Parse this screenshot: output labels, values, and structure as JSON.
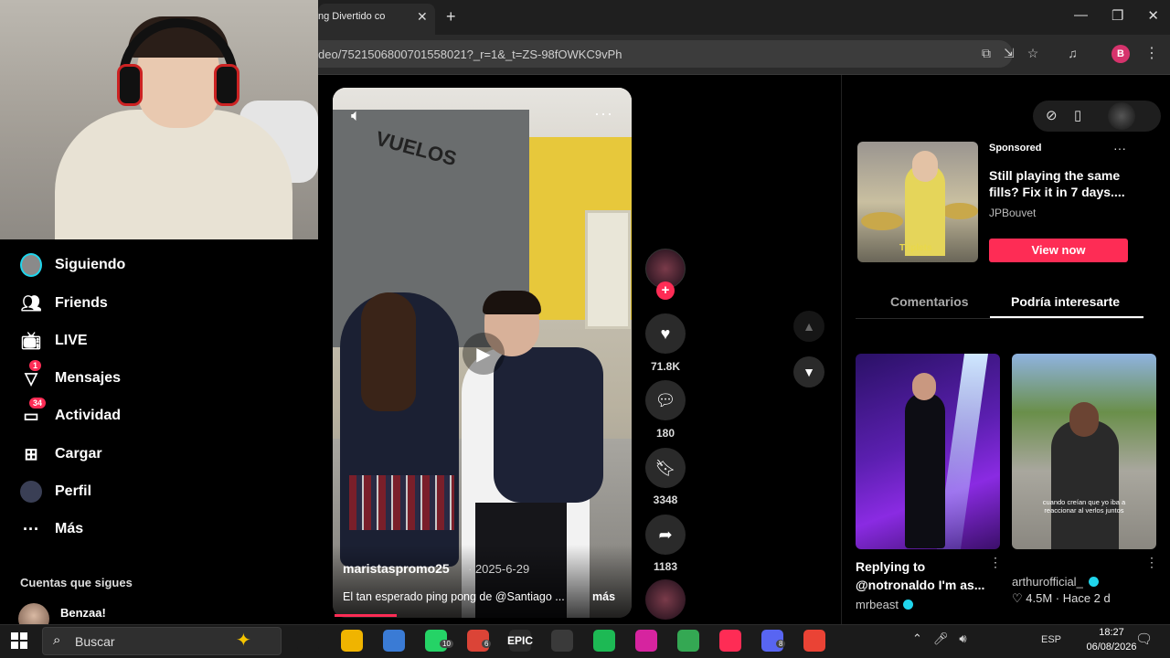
{
  "browser": {
    "tab_title": "ng Divertido co",
    "tab_close": "✕",
    "new_tab": "+",
    "window_controls": [
      "—",
      "❐",
      "✕"
    ],
    "url": "deo/7521506800701558021?_r=1&_t=ZS-98fOWKC9vPh",
    "profile_letter": "B",
    "menu": "⋮"
  },
  "sidebar": {
    "items": [
      {
        "label": "Siguiendo",
        "icon": "following-avatar-icon"
      },
      {
        "label": "Friends",
        "icon": "friends-icon"
      },
      {
        "label": "LIVE",
        "icon": "live-icon"
      },
      {
        "label": "Mensajes",
        "icon": "messages-icon",
        "badge": "1"
      },
      {
        "label": "Actividad",
        "icon": "activity-icon",
        "badge": "34"
      },
      {
        "label": "Cargar",
        "icon": "upload-icon"
      },
      {
        "label": "Perfil",
        "icon": "profile-avatar-icon"
      },
      {
        "label": "Más",
        "icon": "more-icon"
      }
    ],
    "following_title": "Cuentas que sigues",
    "following_accounts": [
      {
        "name": "Benzaa!"
      }
    ]
  },
  "video": {
    "author": "maristaspromo25",
    "date": "· 2025-6-29",
    "caption": "El tan esperado ping pong de @Santiago ...",
    "more_label": "más",
    "board_text": "VUELOS",
    "progress": 0.21
  },
  "actions": {
    "likes": "71.8K",
    "comments": "180",
    "saves": "3348",
    "shares": "1183"
  },
  "right_panel": {
    "ad": {
      "sponsored": "Sponsored",
      "title": "Still playing the same fills? Fix it in 7 days....",
      "brand": "JPBouvet",
      "cta": "View now",
      "thumb_overlay": "Triplets"
    },
    "tabs": [
      "Comentarios",
      "Podría interesarte"
    ],
    "active_tab": "Podría interesarte",
    "recommendations": [
      {
        "title": "Replying to @notronaldo I'm as...",
        "author": "mrbeast",
        "verified": true
      },
      {
        "author": "arthurofficial_",
        "verified": true,
        "stats": "♡ 4.5M · Hace 2 d",
        "overlay_caption": "cuando creían que yo iba a reaccionar al verlos juntos"
      }
    ]
  },
  "taskbar": {
    "search_placeholder": "Buscar",
    "apps": [
      {
        "name": "task-view-icon",
        "color": "#1b1b1b"
      },
      {
        "name": "file-explorer-icon",
        "color": "#f0b400"
      },
      {
        "name": "microsoft-store-icon",
        "color": "#3a7bd5"
      },
      {
        "name": "whatsapp-icon",
        "color": "#25d366",
        "badge": "10"
      },
      {
        "name": "chrome-icon",
        "color": "#db4437",
        "badge": "6"
      },
      {
        "name": "epic-games-icon",
        "color": "#2a2a2a",
        "label": "EPIC"
      },
      {
        "name": "obs-icon",
        "color": "#3a3a3a"
      },
      {
        "name": "spotify-icon",
        "color": "#1db954"
      },
      {
        "name": "instagram-icon",
        "color": "#d6249f"
      },
      {
        "name": "drive-icon",
        "color": "#34a853"
      },
      {
        "name": "tiktok-icon",
        "color": "#fe2c55"
      },
      {
        "name": "discord-icon",
        "color": "#5865f2",
        "badge": "8"
      },
      {
        "name": "chrome-alt-icon",
        "color": "#ea4335"
      }
    ],
    "language": "ESP",
    "time": "18:27",
    "date": "06/08/2026"
  },
  "colors": {
    "accent": "#fe2c55",
    "verified": "#20d5ec",
    "background": "#000000"
  }
}
